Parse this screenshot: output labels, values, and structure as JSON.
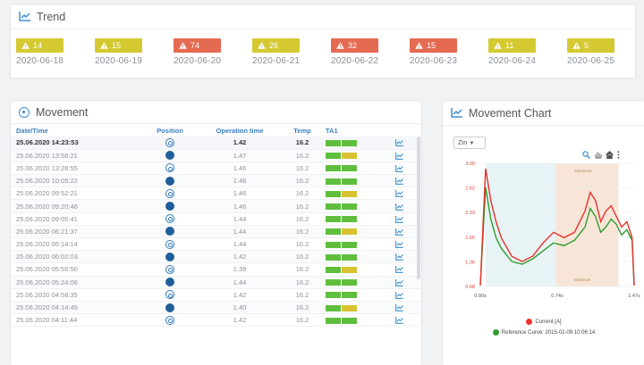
{
  "trend": {
    "title": "Trend",
    "badges": [
      {
        "value": "14",
        "date": "2020-06-18",
        "color": "yellow"
      },
      {
        "value": "15",
        "date": "2020-06-19",
        "color": "yellow"
      },
      {
        "value": "74",
        "date": "2020-06-20",
        "color": "red"
      },
      {
        "value": "26",
        "date": "2020-06-21",
        "color": "yellow"
      },
      {
        "value": "32",
        "date": "2020-06-22",
        "color": "red"
      },
      {
        "value": "15",
        "date": "2020-06-23",
        "color": "red"
      },
      {
        "value": "11",
        "date": "2020-06-24",
        "color": "yellow"
      },
      {
        "value": "5",
        "date": "2020-06-25",
        "color": "yellow"
      }
    ]
  },
  "movement": {
    "title": "Movement",
    "columns": [
      "Date/Time",
      "Position",
      "Operation time",
      "Temp",
      "TA1"
    ],
    "rows": [
      {
        "datetime": "25.06.2020 14:23:53",
        "position": "open",
        "op_time": "1.42",
        "temp": "16.2",
        "ta": [
          "g",
          "g"
        ],
        "bold": true
      },
      {
        "datetime": "25.06.2020 13:56:21",
        "position": "filled",
        "op_time": "1.47",
        "temp": "16.2",
        "ta": [
          "g",
          "y"
        ]
      },
      {
        "datetime": "25.06.2020 13:28:55",
        "position": "open",
        "op_time": "1.46",
        "temp": "16.2",
        "ta": [
          "g",
          "g"
        ]
      },
      {
        "datetime": "25.06.2020 10:05:22",
        "position": "filled",
        "op_time": "1.46",
        "temp": "16.2",
        "ta": [
          "g",
          "g"
        ]
      },
      {
        "datetime": "25.06.2020 09:52:21",
        "position": "open",
        "op_time": "1.46",
        "temp": "16.2",
        "ta": [
          "g",
          "y"
        ]
      },
      {
        "datetime": "25.06.2020 09:20:46",
        "position": "filled",
        "op_time": "1.46",
        "temp": "16.2",
        "ta": [
          "g",
          "g"
        ]
      },
      {
        "datetime": "25.06.2020 09:05:41",
        "position": "open",
        "op_time": "1.44",
        "temp": "16.2",
        "ta": [
          "g",
          "g"
        ]
      },
      {
        "datetime": "25.06.2020 06:21:37",
        "position": "filled",
        "op_time": "1.44",
        "temp": "16.2",
        "ta": [
          "g",
          "y"
        ]
      },
      {
        "datetime": "25.06.2020 06:14:14",
        "position": "open",
        "op_time": "1.44",
        "temp": "16.2",
        "ta": [
          "g",
          "g"
        ]
      },
      {
        "datetime": "25.06.2020 06:02:03",
        "position": "filled",
        "op_time": "1.42",
        "temp": "16.2",
        "ta": [
          "g",
          "g"
        ]
      },
      {
        "datetime": "25.06.2020 05:55:50",
        "position": "open",
        "op_time": "1.39",
        "temp": "16.2",
        "ta": [
          "g",
          "y"
        ]
      },
      {
        "datetime": "25.06.2020 05:24:06",
        "position": "filled",
        "op_time": "1.44",
        "temp": "16.2",
        "ta": [
          "g",
          "g"
        ]
      },
      {
        "datetime": "25.06.2020 04:58:35",
        "position": "open",
        "op_time": "1.42",
        "temp": "16.2",
        "ta": [
          "g",
          "g"
        ]
      },
      {
        "datetime": "25.06.2020 04:14:49",
        "position": "filled",
        "op_time": "1.40",
        "temp": "16.2",
        "ta": [
          "g",
          "y"
        ]
      },
      {
        "datetime": "25.06.2020 04:11:44",
        "position": "open",
        "op_time": "1.42",
        "temp": "16.2",
        "ta": [
          "g",
          "g"
        ]
      }
    ]
  },
  "chart": {
    "title": "Movement Chart",
    "select_value": "Zin",
    "legend_current": "Current [A]",
    "legend_reference": "Reference Curve: 2015-02-09 10:06:14",
    "color_current": "#e8312c",
    "color_reference": "#2f9d2f"
  },
  "chart_data": {
    "type": "line",
    "y_ticks": [
      "3.00",
      "2.62",
      "2.33",
      "1.65",
      "1.36",
      "0.68"
    ],
    "x_ticks": [
      "0.00s",
      "0.74s",
      "1.47s"
    ],
    "band_labels": [
      "Maximum",
      "Minimum"
    ],
    "series": [
      {
        "name": "Current [A]",
        "x": [
          0,
          0.05,
          0.1,
          0.15,
          0.2,
          0.3,
          0.4,
          0.5,
          0.6,
          0.7,
          0.8,
          0.9,
          1.0,
          1.05,
          1.1,
          1.15,
          1.2,
          1.25,
          1.3,
          1.35,
          1.4,
          1.45,
          1.47
        ],
        "y": [
          0.7,
          2.9,
          2.3,
          1.9,
          1.6,
          1.25,
          1.15,
          1.25,
          1.5,
          1.7,
          1.6,
          1.7,
          2.1,
          2.45,
          2.3,
          1.9,
          2.1,
          2.2,
          2.0,
          1.8,
          1.9,
          1.6,
          0.7
        ]
      },
      {
        "name": "Reference Curve: 2015-02-09 10:06:14",
        "x": [
          0,
          0.05,
          0.1,
          0.15,
          0.2,
          0.3,
          0.4,
          0.5,
          0.6,
          0.7,
          0.8,
          0.9,
          1.0,
          1.05,
          1.1,
          1.15,
          1.2,
          1.25,
          1.3,
          1.35,
          1.4,
          1.45,
          1.47
        ],
        "y": [
          0.7,
          2.55,
          1.95,
          1.6,
          1.4,
          1.15,
          1.1,
          1.2,
          1.35,
          1.5,
          1.45,
          1.55,
          1.8,
          2.15,
          2.0,
          1.7,
          1.8,
          1.95,
          1.85,
          1.65,
          1.75,
          1.55,
          0.7
        ]
      }
    ]
  }
}
